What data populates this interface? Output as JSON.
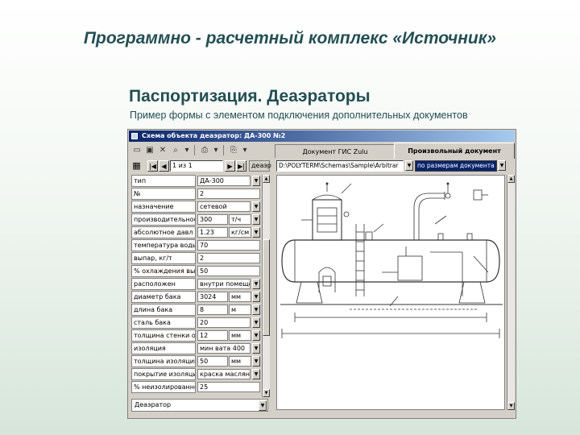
{
  "slide": {
    "title": "Программно - расчетный комплекс «Источник»",
    "subtitle": "Паспортизация. Деаэраторы",
    "caption": "Пример формы с элементом подключения дополнительных документов"
  },
  "window": {
    "title": "Схема объекта деаэратор: ДА-300 №2",
    "tabs": [
      {
        "label": "Документ ГИС Zulu",
        "active": false
      },
      {
        "label": "Произвольный документ",
        "active": true
      }
    ],
    "nav": {
      "record": "1 из 1",
      "object_type": "деаэр"
    },
    "properties": [
      {
        "label": "тип",
        "value": "ДА-300",
        "unit": "",
        "dropdown": true
      },
      {
        "label": "№",
        "value": "2",
        "unit": "",
        "dropdown": false
      },
      {
        "label": "назначение",
        "value": "сетевой",
        "unit": "",
        "dropdown": true
      },
      {
        "label": "производительност",
        "value": "300",
        "unit": "т/ч",
        "dropdown": true
      },
      {
        "label": "абсолютное давл",
        "value": "1.23",
        "unit": "кг/см",
        "dropdown": true
      },
      {
        "label": "температура воды",
        "value": "70",
        "unit": "",
        "dropdown": false
      },
      {
        "label": "выпар, кг/т",
        "value": "2",
        "unit": "",
        "dropdown": false
      },
      {
        "label": "% охлаждения выпа",
        "value": "50",
        "unit": "",
        "dropdown": false
      },
      {
        "label": "расположен",
        "value": "внутри помещен",
        "unit": "",
        "dropdown": true
      },
      {
        "label": "диаметр бака",
        "value": "3024",
        "unit": "мм",
        "dropdown": true
      },
      {
        "label": "длина бака",
        "value": "8",
        "unit": "м",
        "dropdown": true
      },
      {
        "label": "сталь бака",
        "value": "20",
        "unit": "",
        "dropdown": true
      },
      {
        "label": "толщина стенки об",
        "value": "12",
        "unit": "мм",
        "dropdown": true
      },
      {
        "label": "изоляция",
        "value": "мин вата 400",
        "unit": "",
        "dropdown": true
      },
      {
        "label": "толщина изоляции",
        "value": "50",
        "unit": "мм",
        "dropdown": true
      },
      {
        "label": "покрытие изоляции",
        "value": "краска масляна",
        "unit": "",
        "dropdown": true
      },
      {
        "label": "% неизолированной",
        "value": "25",
        "unit": "",
        "dropdown": false
      }
    ],
    "object_selector": "Деаэратор",
    "document": {
      "path": "D:\\POLYTERM\\Schemas\\Sample\\Arbitrar",
      "zoom": "по размерам документа"
    }
  }
}
